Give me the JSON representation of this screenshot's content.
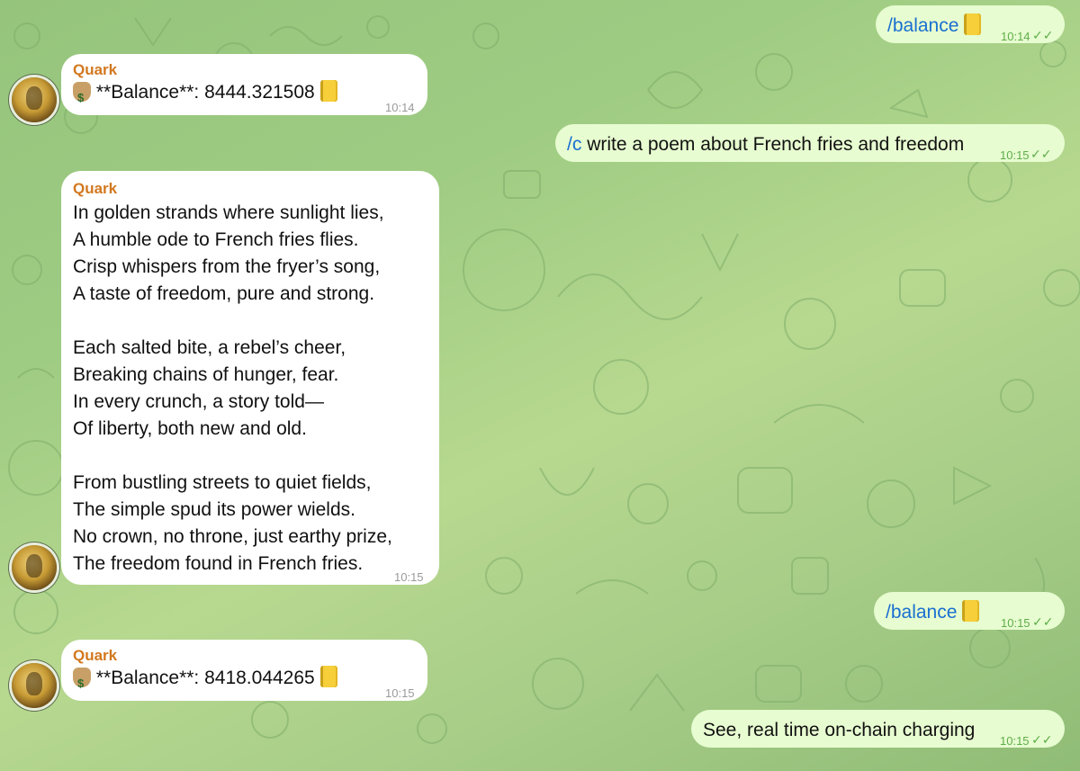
{
  "sender_name": "Quark",
  "messages": [
    {
      "direction": "out",
      "command": "/balance",
      "emoji": "ledger-icon",
      "time": "10:14",
      "status": "read"
    },
    {
      "direction": "in",
      "sender": "Quark",
      "prefix_emoji": "money-bag-icon",
      "text": "**Balance**: 8444.321508",
      "suffix_emoji": "ledger-icon",
      "time": "10:14"
    },
    {
      "direction": "out",
      "command": "/c",
      "text": "write a poem about French fries and freedom",
      "time": "10:15",
      "status": "read"
    },
    {
      "direction": "in",
      "sender": "Quark",
      "lines": [
        "In golden strands where sunlight lies,",
        "A humble ode to French fries flies.",
        "Crisp whispers from the fryer’s song,",
        "A taste of freedom, pure and strong.",
        "",
        "Each salted bite, a rebel’s cheer,",
        "Breaking chains of hunger, fear.",
        "In every crunch, a story told—",
        "Of liberty, both new and old.",
        "",
        "From bustling streets to quiet fields,",
        "The simple spud its power wields.",
        "No crown, no throne, just earthy prize,",
        "The freedom found in French fries."
      ],
      "time": "10:15"
    },
    {
      "direction": "out",
      "command": "/balance",
      "emoji": "ledger-icon",
      "time": "10:15",
      "status": "read"
    },
    {
      "direction": "in",
      "sender": "Quark",
      "prefix_emoji": "money-bag-icon",
      "text": "**Balance**: 8418.044265",
      "suffix_emoji": "ledger-icon",
      "time": "10:15"
    },
    {
      "direction": "out",
      "text": "See, real time on-chain charging",
      "time": "10:15",
      "status": "read"
    }
  ],
  "colors": {
    "sender_name": "#d2781f",
    "command_link": "#1a6fd0",
    "outgoing_bubble": "#e7fcd0",
    "incoming_bubble": "#ffffff",
    "read_checks": "#5fad4a"
  }
}
